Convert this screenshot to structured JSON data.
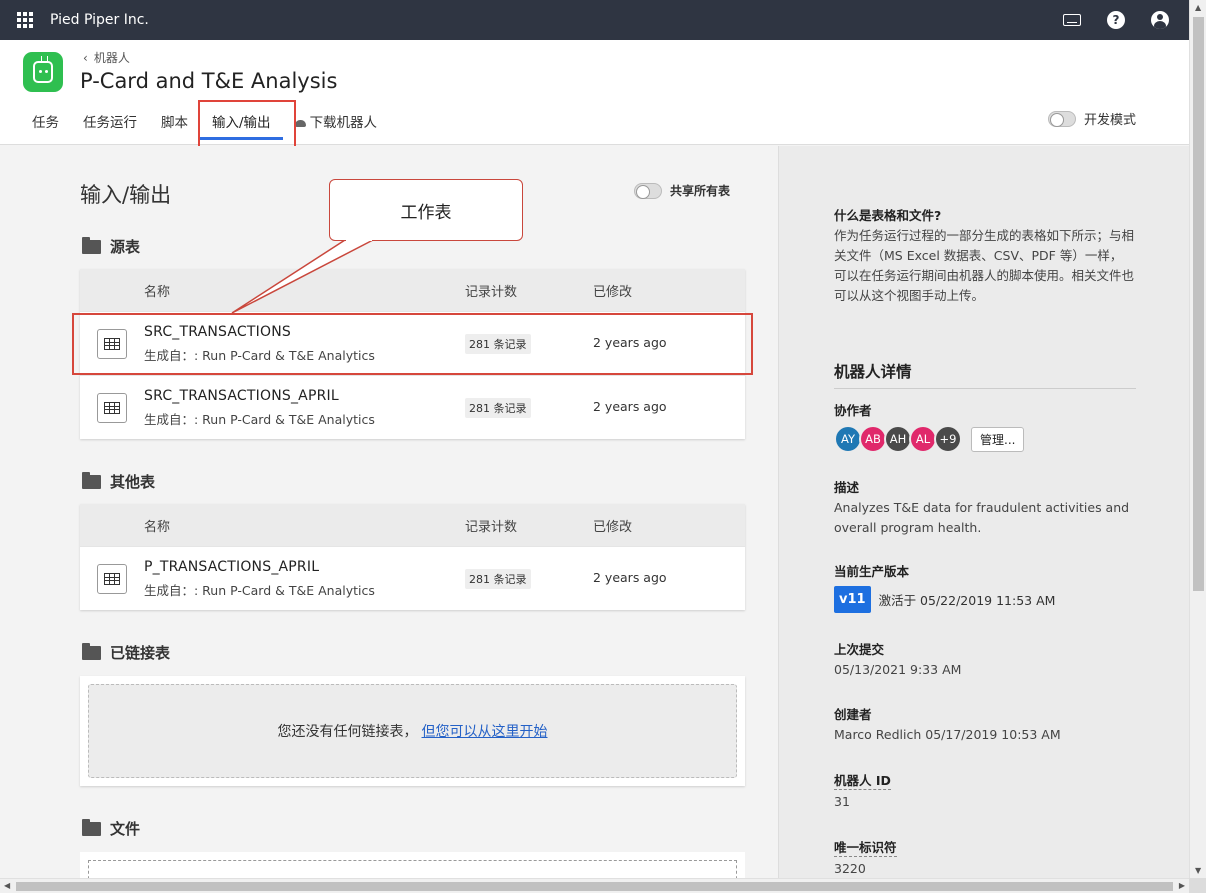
{
  "topbar": {
    "org_name": "Pied Piper Inc.",
    "icons": [
      "apps-grid-icon",
      "keyboard-icon",
      "help-icon",
      "user-icon"
    ]
  },
  "header": {
    "breadcrumb": "机器人",
    "title": "P-Card and T&E Analysis",
    "tabs": [
      {
        "label": "任务"
      },
      {
        "label": "任务运行"
      },
      {
        "label": "脚本"
      },
      {
        "label": "输入/输出"
      },
      {
        "label": "下载机器人"
      }
    ],
    "active_tab": "输入/输出",
    "dev_mode_label": "开发模式"
  },
  "main": {
    "section_title": "输入/输出",
    "share_all_label": "共享所有表",
    "callout_text": "工作表",
    "columns": {
      "name": "名称",
      "count": "记录计数",
      "modified": "已修改"
    },
    "source_tables": {
      "title": "源表",
      "rows": [
        {
          "name": "SRC_TRANSACTIONS",
          "source": "生成自：: Run P-Card & T&E Analytics",
          "count": "281 条记录",
          "modified": "2 years ago"
        },
        {
          "name": "SRC_TRANSACTIONS_APRIL",
          "source": "生成自：: Run P-Card & T&E Analytics",
          "count": "281 条记录",
          "modified": "2 years ago"
        }
      ]
    },
    "other_tables": {
      "title": "其他表",
      "rows": [
        {
          "name": "P_TRANSACTIONS_APRIL",
          "source": "生成自：: Run P-Card & T&E Analytics",
          "count": "281 条记录",
          "modified": "2 years ago"
        }
      ]
    },
    "linked_tables": {
      "title": "已链接表",
      "empty_text": "您还没有任何链接表，",
      "empty_link": "但您可以从这里开始"
    },
    "files": {
      "title": "文件"
    }
  },
  "side": {
    "what_title": "什么是表格和文件?",
    "what_body": "作为任务运行过程的一部分生成的表格如下所示；与相关文件（MS Excel 数据表、CSV、PDF 等）一样，可以在任务运行期间由机器人的脚本使用。相关文件也可以从这个视图手动上传。",
    "details_title": "机器人详情",
    "collaborators_label": "协作者",
    "avatars": [
      {
        "initials": "AY",
        "color": "#1f78b4"
      },
      {
        "initials": "AB",
        "color": "#e0286b"
      },
      {
        "initials": "AH",
        "color": "#4a4a4a"
      },
      {
        "initials": "AL",
        "color": "#e0286b"
      },
      {
        "initials": "+9",
        "color": "#4a4a4a"
      }
    ],
    "manage_label": "管理...",
    "desc_label": "描述",
    "desc_text": "Analyzes T&E data for fraudulent activities and overall program health.",
    "version_label": "当前生产版本",
    "version_badge": "v11",
    "version_text": "激活于 05/22/2019 11:53 AM",
    "last_commit_label": "上次提交",
    "last_commit_text": "05/13/2021 9:33 AM",
    "creator_label": "创建者",
    "creator_text": "Marco Redlich 05/17/2019 10:53 AM",
    "robot_id_label": "机器人 ID",
    "robot_id": "31",
    "uid_label": "唯一标识符",
    "uid": "3220"
  }
}
